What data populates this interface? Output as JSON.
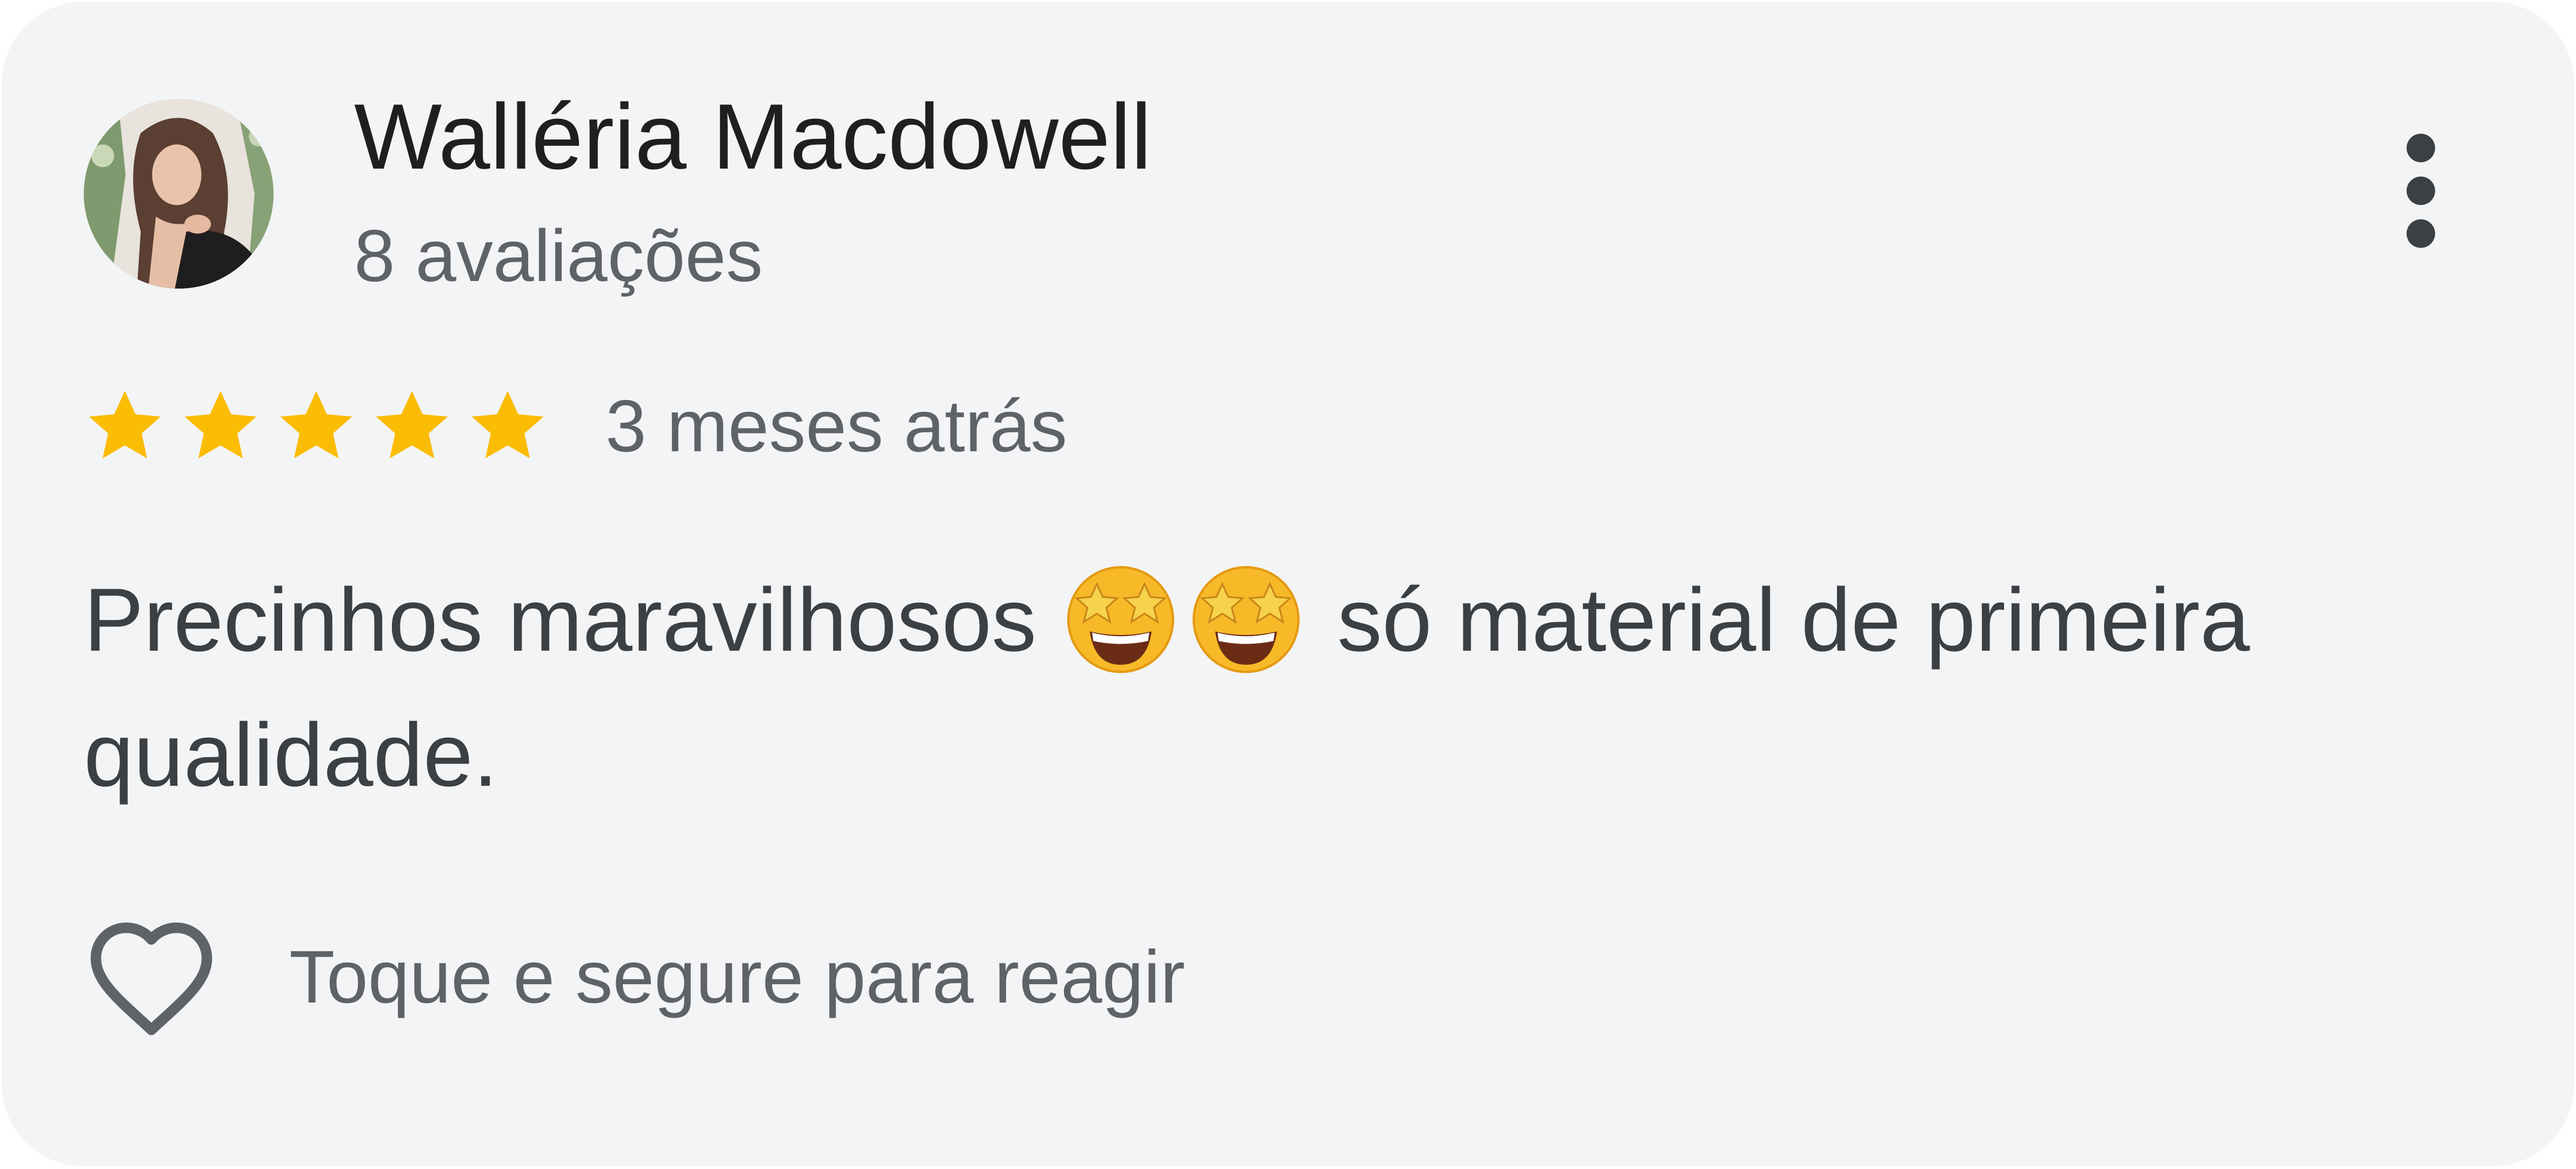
{
  "review": {
    "reviewer_name": "Walléria Macdowell",
    "review_count": "8 avaliações",
    "rating": 5,
    "rating_max": 5,
    "date": "3 meses atrás",
    "text_before_emoji": "Precinhos maravilhosos ",
    "emojis": [
      "star-struck-emoji",
      "star-struck-emoji"
    ],
    "text_after_emoji": " só material de primeira qualidade.",
    "react_label": "Toque e segure para reagir"
  },
  "icons": {
    "more": "more-vert-icon",
    "star": "star-icon",
    "heart": "heart-outline-icon"
  },
  "colors": {
    "card_background": "#f3f4f6",
    "star": "#fbbc04",
    "name": "#1f1f1f",
    "secondary_text": "#5f6368",
    "body_text": "#3c4043"
  }
}
